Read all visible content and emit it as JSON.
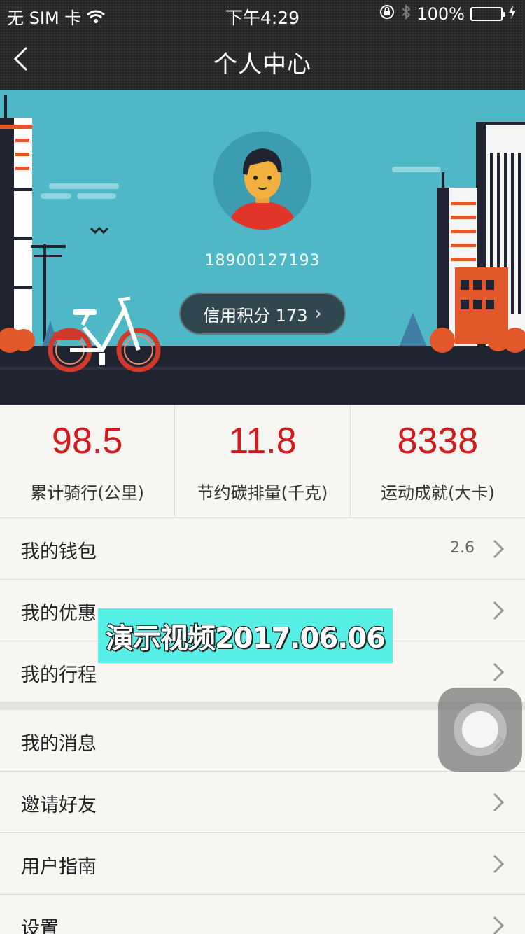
{
  "status_bar": {
    "carrier": "无 SIM 卡",
    "time": "下午4:29",
    "battery": "100%"
  },
  "nav": {
    "title": "个人中心"
  },
  "profile": {
    "phone": "18900127193",
    "credit_label": "信用积分 173"
  },
  "stats": [
    {
      "value": "98.5",
      "label": "累计骑行(公里)"
    },
    {
      "value": "11.8",
      "label": "节约碳排量(千克)"
    },
    {
      "value": "8338",
      "label": "运动成就(大卡)"
    }
  ],
  "menu_group_1": [
    {
      "label": "我的钱包",
      "value": "2.6"
    },
    {
      "label": "我的优惠",
      "value": ""
    },
    {
      "label": "我的行程",
      "value": ""
    }
  ],
  "menu_group_2": [
    {
      "label": "我的消息"
    },
    {
      "label": "邀请好友"
    },
    {
      "label": "用户指南"
    },
    {
      "label": "设置"
    }
  ],
  "overlay": {
    "watermark": "演示视频2017.06.06"
  },
  "colors": {
    "accent_red": "#d5191c",
    "hero_sky": "#4fb8c7",
    "battery_green": "#4cd964"
  }
}
